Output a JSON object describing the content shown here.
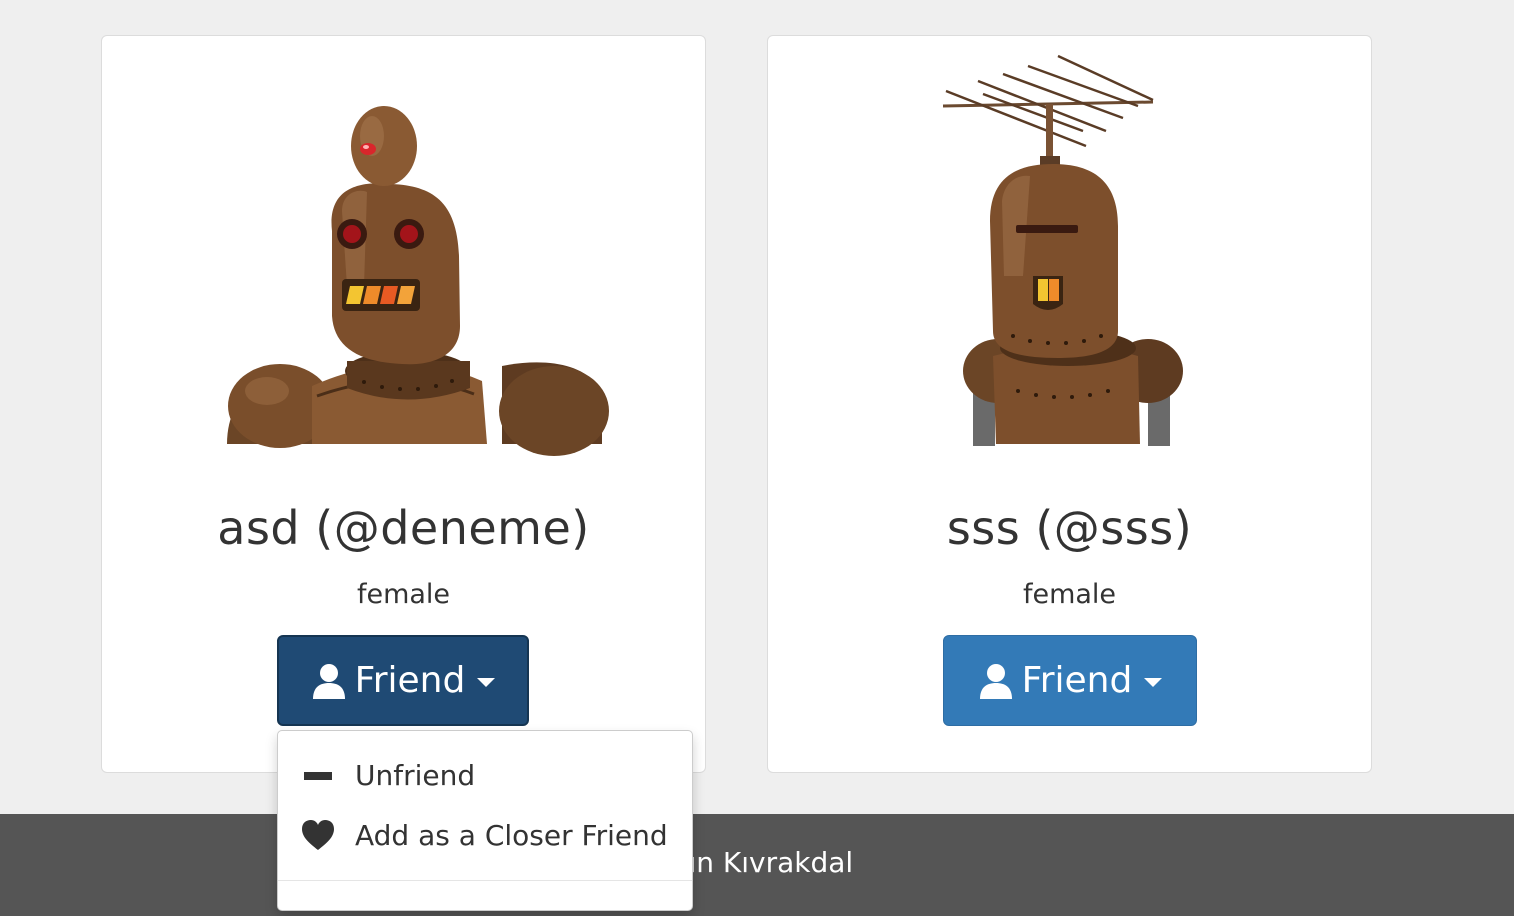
{
  "cards": [
    {
      "display_name": "asd (@deneme)",
      "gender": "female",
      "button_label": "Friend",
      "button_icon": "user-icon",
      "button_state": "active"
    },
    {
      "display_name": "sss (@sss)",
      "gender": "female",
      "button_label": "Friend",
      "button_icon": "user-icon",
      "button_state": "default"
    }
  ],
  "dropdown": {
    "items": [
      {
        "label": "Unfriend",
        "icon": "minus-icon"
      },
      {
        "label": "Add as a Closer Friend",
        "icon": "heart-icon"
      }
    ]
  },
  "footer": {
    "author": "Özgün Kıvrakdal"
  },
  "colors": {
    "button_active": "#1f4a74",
    "button_primary": "#337ab7",
    "footer_bg": "#555555",
    "page_bg": "#efefef"
  }
}
